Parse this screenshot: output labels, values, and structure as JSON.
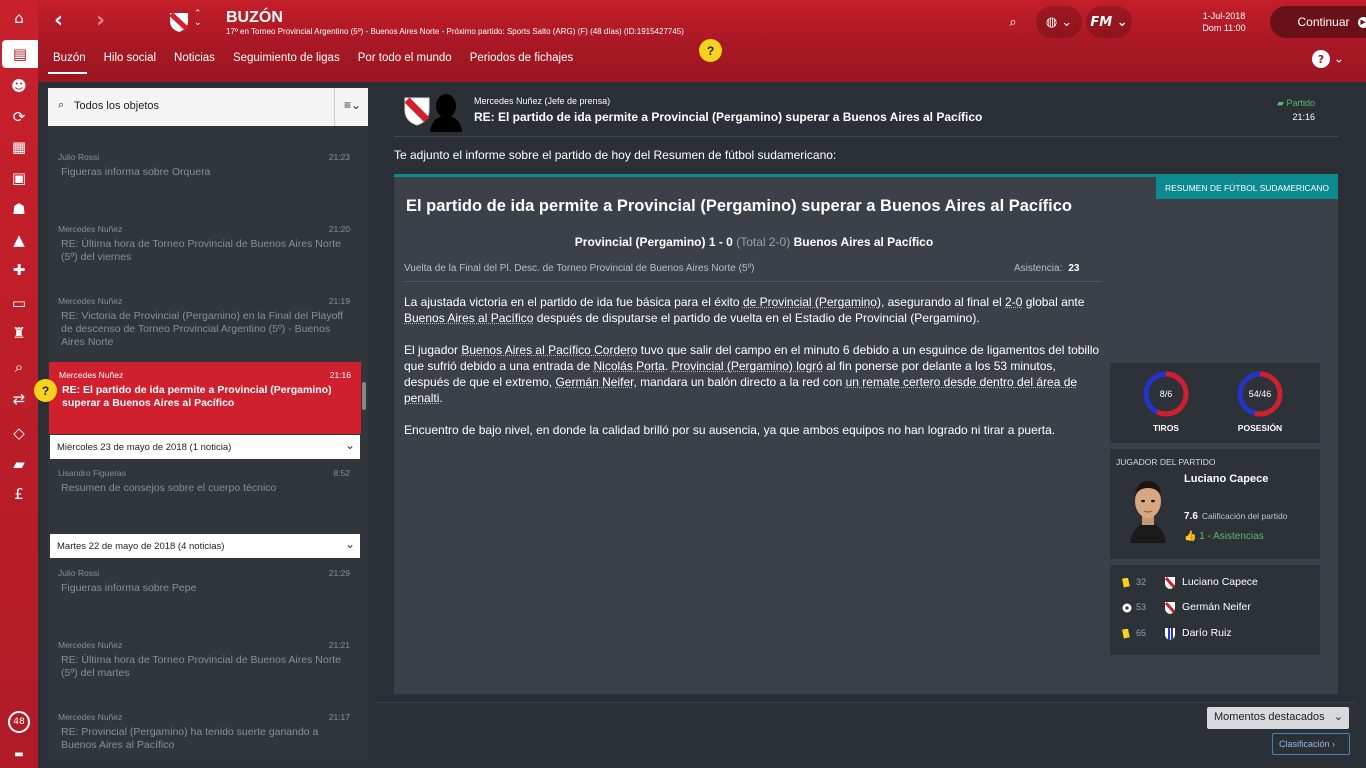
{
  "header": {
    "title": "BUZÓN",
    "subtitle": "17º en Torneo Provincial Argentino (5º) - Buenos Aires Norte - Próximo partido: Sports Salto (ARG) (F) (48 días) (ID:1915427745)",
    "date_line1": "1-Jul-2018",
    "date_line2": "Dom 11:00",
    "continue_label": "Continuar",
    "fm_label": "FM"
  },
  "tabs": [
    "Buzón",
    "Hilo social",
    "Noticias",
    "Seguimiento de ligas",
    "Por todo el mundo",
    "Periodos de fichajes"
  ],
  "help_mark": "?",
  "sidebar": {
    "badge": "48"
  },
  "inbox": {
    "search_label": "Todos los objetos",
    "messages": [
      {
        "sender": "Julio Rossi",
        "time": "21:23",
        "subject": "Figueras informa sobre Orquera"
      },
      {
        "sender": "Mercedes Nuñez",
        "time": "21:20",
        "subject": "RE: Última hora de Torneo Provincial de Buenos Aires Norte (5º) del viernes"
      },
      {
        "sender": "Mercedes Nuñez",
        "time": "21:19",
        "subject": "RE: Victoria de Provincial (Pergamino) en la Final del Playoff de descenso de Torneo Provincial Argentino (5º) - Buenos Aires Norte"
      },
      {
        "sender": "Mercedes Nuñez",
        "time": "21:16",
        "subject": "RE: El partido de ida permite a Provincial (Pergamino) superar a Buenos Aires al Pacífico"
      }
    ],
    "day1": "Miércoles 23 de mayo de 2018 (1 noticia)",
    "day1_messages": [
      {
        "sender": "Lisandro Figueras",
        "time": "8:52",
        "subject": "Resumen de consejos sobre el cuerpo técnico"
      }
    ],
    "day2": "Martes 22 de mayo de 2018 (4 noticias)",
    "day2_messages": [
      {
        "sender": "Julio Rossi",
        "time": "21:29",
        "subject": "Figueras informa sobre Pepe"
      },
      {
        "sender": "Mercedes Nuñez",
        "time": "21:21",
        "subject": "RE: Última hora de Torneo Provincial de Buenos Aires Norte (5º) del martes"
      },
      {
        "sender": "Mercedes Nuñez",
        "time": "21:17",
        "subject": "RE: Provincial (Pergamino) ha tenido suerte ganando a Buenos Aires al Pacífico"
      }
    ]
  },
  "message": {
    "sender": "Mercedes Nuñez  (Jefe de prensa)",
    "subject": "RE: El partido de ida permite a Provincial (Pergamino) superar a Buenos Aires al Pacífico",
    "status": "Partido",
    "time": "21:16",
    "intro": "Te adjunto el informe sobre el partido de hoy del Resumen de fútbol sudamericano:"
  },
  "report": {
    "source": "RESUMEN DE FÚTBOL SUDAMERICANO",
    "title": "El partido de ida permite a Provincial (Pergamino) superar a Buenos Aires al Pacífico",
    "home": "Provincial (Pergamino)",
    "score": "1 - 0",
    "aggregate": "(Total 2-0)",
    "away": "Buenos Aires al Pacífico",
    "competition": "Vuelta de la Final del Pl. Desc. de Torneo Provincial de Buenos Aires Norte (5º)",
    "attendance_label": "Asistencia:",
    "attendance": "23",
    "p1": [
      "La ajustada victoria en el partido de ida fue básica para el éxito ",
      "de Provincial (Pergamino)",
      ", asegurando al final el ",
      "2-0",
      " global ante ",
      "Buenos Aires al Pacífico",
      " después de disputarse el partido de vuelta en el Estadio de Provincial (Pergamino)."
    ],
    "p2": [
      "El jugador ",
      "Buenos Aires al Pacífico Cordero",
      " tuvo que salir del campo en el minuto 6 debido a un esguince de ligamentos del tobillo que sufrió debido a una entrada de ",
      "Nicolás Porta",
      ". ",
      "Provincial (Pergamino) logró",
      " al fin ponerse por delante a los 53 minutos, después de que el extremo, ",
      "Germán Neifer",
      ", mandara un balón directo a la red con ",
      "un remate certero desde dentro del área de penalti",
      "."
    ],
    "p3": "Encuentro de bajo nivel, en donde la calidad brilló por su ausencia, ya que ambos equipos no han logrado ni tirar a puerta.",
    "shots_value": "8/6",
    "shots_label": "TIROS",
    "shots_home": 8,
    "shots_away": 6,
    "possession_value": "54/46",
    "possession_label": "POSESIÓN",
    "possession_home": 54,
    "possession_away": 46,
    "potm_heading": "JUGADOR DEL PARTIDO",
    "potm_name": "Luciano Capece",
    "potm_rating": "7.6",
    "potm_rating_label": "Calificación del partido",
    "potm_assists": "1 - Asistencias",
    "events": [
      {
        "type": "yellow-card",
        "minute": "32",
        "player": "Luciano Capece",
        "team": "home"
      },
      {
        "type": "goal",
        "minute": "53",
        "player": "Germán Neifer",
        "team": "home"
      },
      {
        "type": "yellow-card",
        "minute": "65",
        "player": "Darío Ruiz",
        "team": "away"
      }
    ]
  },
  "bottom": {
    "moments": "Momentos destacados",
    "ranking": "Clasificación"
  },
  "colors": {
    "brand_red": "#c41e2a",
    "teal": "#0d8a8f",
    "yellow": "#f6d31c",
    "ring_red": "#d01f2d",
    "ring_blue": "#2434c8"
  }
}
